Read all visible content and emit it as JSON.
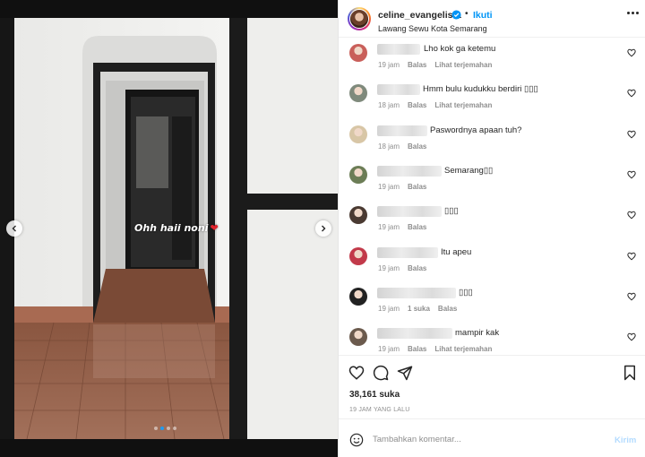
{
  "post": {
    "overlay_text": "Ohh haii noni",
    "overlay_emoji": "❤",
    "carousel": {
      "count": 4,
      "active_index": 1
    }
  },
  "header": {
    "username": "celine_evangelista",
    "bullet": "•",
    "follow_label": "Ikuti",
    "location": "Lawang Sewu Kota Semarang"
  },
  "comments": [
    {
      "text": "Lho kok ga ketemu",
      "time": "19 jam",
      "likes": "",
      "reply": "Balas",
      "translate": "Lihat terjemahan",
      "avatar_color": "#c95f5a"
    },
    {
      "text": "Hmm bulu kudukku berdiri ▯▯▯",
      "time": "18 jam",
      "likes": "",
      "reply": "Balas",
      "translate": "Lihat terjemahan",
      "avatar_color": "#7f8a7c"
    },
    {
      "text": "Paswordnya apaan tuh?",
      "time": "18 jam",
      "likes": "",
      "reply": "Balas",
      "translate": "",
      "avatar_color": "#d8c6a6"
    },
    {
      "text": "Semarang▯▯",
      "time": "19 jam",
      "likes": "",
      "reply": "Balas",
      "translate": "",
      "avatar_color": "#6c7d56"
    },
    {
      "text": "▯▯▯",
      "time": "19 jam",
      "likes": "",
      "reply": "Balas",
      "translate": "",
      "avatar_color": "#4a3a32"
    },
    {
      "text": "Itu apeu",
      "time": "19 jam",
      "likes": "",
      "reply": "Balas",
      "translate": "",
      "avatar_color": "#c23a4a"
    },
    {
      "text": "▯▯▯",
      "time": "19 jam",
      "likes": "1 suka",
      "reply": "Balas",
      "translate": "",
      "avatar_color": "#222222"
    },
    {
      "text": "mampir kak",
      "time": "19 jam",
      "likes": "",
      "reply": "Balas",
      "translate": "Lihat terjemahan",
      "avatar_color": "#6b5a4d"
    }
  ],
  "engagement": {
    "likes_count": "38,161 suka",
    "time_ago": "19 JAM YANG LALU"
  },
  "composer": {
    "placeholder": "Tambahkan komentar...",
    "post_label": "Kirim"
  },
  "colors": {
    "accent": "#0095f6",
    "verified": "#0095f6",
    "text_primary": "#262626",
    "text_secondary": "#8e8e8e",
    "post_disabled": "#b3dbff"
  }
}
